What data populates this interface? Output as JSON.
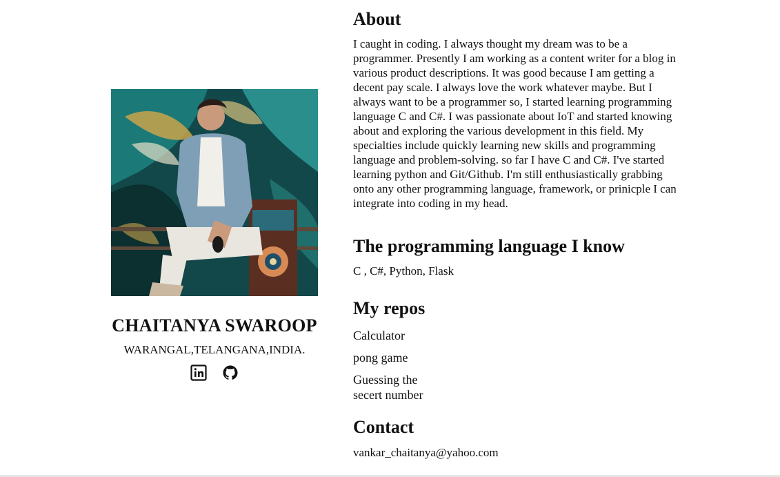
{
  "profile": {
    "name": "CHAITANYA SWAROOP",
    "location": "WARANGAL,TELANGANA,INDIA.",
    "socials": [
      {
        "icon": "linkedin-icon"
      },
      {
        "icon": "github-icon"
      }
    ]
  },
  "about": {
    "title": "About",
    "text": "I caught in coding. I always thought my dream was to be a programmer. Presently I am working as a content writer for a blog in various product descriptions. It was good because I am getting a decent pay scale. I always love the work whatever maybe. But I always want to be a programmer so, I started learning programming language C and C#. I was passionate about IoT and started knowing about and exploring the various development in this field. My specialties include quickly learning new skills and programming language and problem-solving. so far I have C and C#. I've started learning python and Git/Github. I'm still enthusiastically grabbing onto any other programming language, framework, or prinicple I can integrate into coding in my head."
  },
  "languages": {
    "title": "The programming language I know",
    "text": "C , C#, Python, Flask"
  },
  "repos": {
    "title": "My repos",
    "items": [
      "Calculator",
      "pong game",
      "Guessing the secert number"
    ]
  },
  "contact": {
    "title": "Contact",
    "email": "vankar_chaitanya@yahoo.com"
  },
  "colors": {
    "text": "#111111",
    "background": "#ffffff"
  }
}
